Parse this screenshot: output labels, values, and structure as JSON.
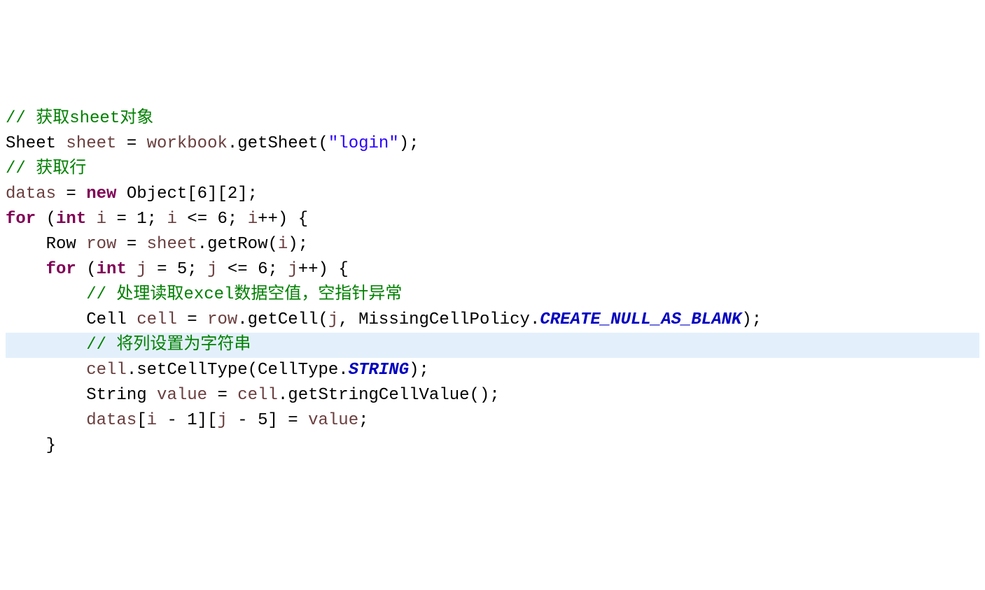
{
  "code": {
    "lines": [
      {
        "highlighted": false,
        "tokens": [
          {
            "class": "comment",
            "text": "// 获取sheet对象"
          }
        ]
      },
      {
        "highlighted": false,
        "tokens": [
          {
            "class": "type",
            "text": "Sheet "
          },
          {
            "class": "identifier",
            "text": "sheet"
          },
          {
            "class": "punctuation",
            "text": " = "
          },
          {
            "class": "identifier",
            "text": "workbook"
          },
          {
            "class": "punctuation",
            "text": ".getSheet("
          },
          {
            "class": "string",
            "text": "\"login\""
          },
          {
            "class": "punctuation",
            "text": ");"
          }
        ]
      },
      {
        "highlighted": false,
        "tokens": [
          {
            "class": "comment",
            "text": "// 获取行"
          }
        ]
      },
      {
        "highlighted": false,
        "tokens": [
          {
            "class": "identifier",
            "text": "datas"
          },
          {
            "class": "punctuation",
            "text": " = "
          },
          {
            "class": "keyword",
            "text": "new"
          },
          {
            "class": "punctuation",
            "text": " Object[6][2];"
          }
        ]
      },
      {
        "highlighted": false,
        "tokens": [
          {
            "class": "keyword",
            "text": "for"
          },
          {
            "class": "punctuation",
            "text": " ("
          },
          {
            "class": "keyword",
            "text": "int"
          },
          {
            "class": "punctuation",
            "text": " "
          },
          {
            "class": "identifier",
            "text": "i"
          },
          {
            "class": "punctuation",
            "text": " = 1; "
          },
          {
            "class": "identifier",
            "text": "i"
          },
          {
            "class": "punctuation",
            "text": " <= 6; "
          },
          {
            "class": "identifier",
            "text": "i"
          },
          {
            "class": "punctuation",
            "text": "++) {"
          }
        ]
      },
      {
        "highlighted": false,
        "tokens": [
          {
            "class": "punctuation",
            "text": "    Row "
          },
          {
            "class": "identifier",
            "text": "row"
          },
          {
            "class": "punctuation",
            "text": " = "
          },
          {
            "class": "identifier",
            "text": "sheet"
          },
          {
            "class": "punctuation",
            "text": ".getRow("
          },
          {
            "class": "identifier",
            "text": "i"
          },
          {
            "class": "punctuation",
            "text": ");"
          }
        ]
      },
      {
        "highlighted": false,
        "tokens": [
          {
            "class": "punctuation",
            "text": "    "
          },
          {
            "class": "keyword",
            "text": "for"
          },
          {
            "class": "punctuation",
            "text": " ("
          },
          {
            "class": "keyword",
            "text": "int"
          },
          {
            "class": "punctuation",
            "text": " "
          },
          {
            "class": "identifier",
            "text": "j"
          },
          {
            "class": "punctuation",
            "text": " = 5; "
          },
          {
            "class": "identifier",
            "text": "j"
          },
          {
            "class": "punctuation",
            "text": " <= 6; "
          },
          {
            "class": "identifier",
            "text": "j"
          },
          {
            "class": "punctuation",
            "text": "++) {"
          }
        ]
      },
      {
        "highlighted": false,
        "tokens": [
          {
            "class": "punctuation",
            "text": "        "
          },
          {
            "class": "comment",
            "text": "// 处理读取excel数据空值，空指针异常"
          }
        ]
      },
      {
        "highlighted": false,
        "tokens": [
          {
            "class": "punctuation",
            "text": "        Cell "
          },
          {
            "class": "identifier",
            "text": "cell"
          },
          {
            "class": "punctuation",
            "text": " = "
          },
          {
            "class": "identifier",
            "text": "row"
          },
          {
            "class": "punctuation",
            "text": ".getCell("
          },
          {
            "class": "identifier",
            "text": "j"
          },
          {
            "class": "punctuation",
            "text": ", MissingCellPolicy."
          },
          {
            "class": "constant",
            "text": "CREATE_NULL_AS_BLANK"
          },
          {
            "class": "punctuation",
            "text": ");"
          }
        ]
      },
      {
        "highlighted": true,
        "tokens": [
          {
            "class": "punctuation",
            "text": "        "
          },
          {
            "class": "comment",
            "text": "// 将列设置为字符串"
          }
        ]
      },
      {
        "highlighted": false,
        "tokens": [
          {
            "class": "punctuation",
            "text": "        "
          },
          {
            "class": "identifier",
            "text": "cell"
          },
          {
            "class": "punctuation",
            "text": ".setCellType(CellType."
          },
          {
            "class": "constant",
            "text": "STRING"
          },
          {
            "class": "punctuation",
            "text": ");"
          }
        ]
      },
      {
        "highlighted": false,
        "tokens": [
          {
            "class": "punctuation",
            "text": "        String "
          },
          {
            "class": "identifier",
            "text": "value"
          },
          {
            "class": "punctuation",
            "text": " = "
          },
          {
            "class": "identifier",
            "text": "cell"
          },
          {
            "class": "punctuation",
            "text": ".getStringCellValue();"
          }
        ]
      },
      {
        "highlighted": false,
        "tokens": [
          {
            "class": "punctuation",
            "text": "        "
          },
          {
            "class": "identifier",
            "text": "datas"
          },
          {
            "class": "punctuation",
            "text": "["
          },
          {
            "class": "identifier",
            "text": "i"
          },
          {
            "class": "punctuation",
            "text": " - 1]["
          },
          {
            "class": "identifier",
            "text": "j"
          },
          {
            "class": "punctuation",
            "text": " - 5] = "
          },
          {
            "class": "identifier",
            "text": "value"
          },
          {
            "class": "punctuation",
            "text": ";"
          }
        ]
      },
      {
        "highlighted": false,
        "tokens": [
          {
            "class": "punctuation",
            "text": "    }"
          }
        ]
      }
    ]
  }
}
